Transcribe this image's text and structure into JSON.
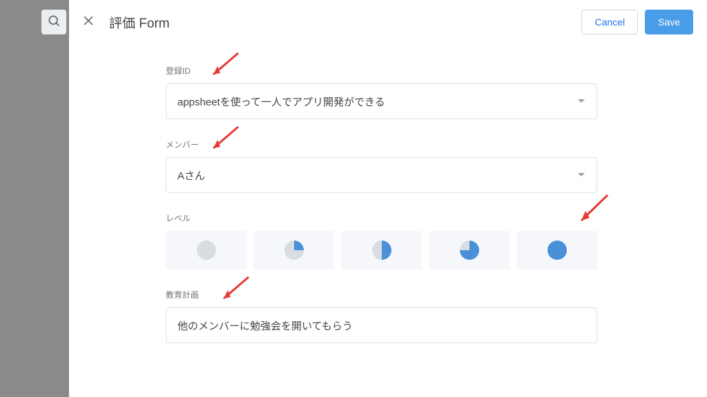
{
  "header": {
    "title": "評価 Form",
    "cancel_label": "Cancel",
    "save_label": "Save"
  },
  "form": {
    "registration_id": {
      "label": "登録ID",
      "value": "appsheetを使って一人でアプリ開発ができる"
    },
    "member": {
      "label": "メンバー",
      "value": "Aさん"
    },
    "level": {
      "label": "レベル",
      "options_pct": [
        0,
        25,
        50,
        75,
        100
      ]
    },
    "education_plan": {
      "label": "教育計画",
      "value": "他のメンバーに勉強会を開いてもらう"
    }
  }
}
